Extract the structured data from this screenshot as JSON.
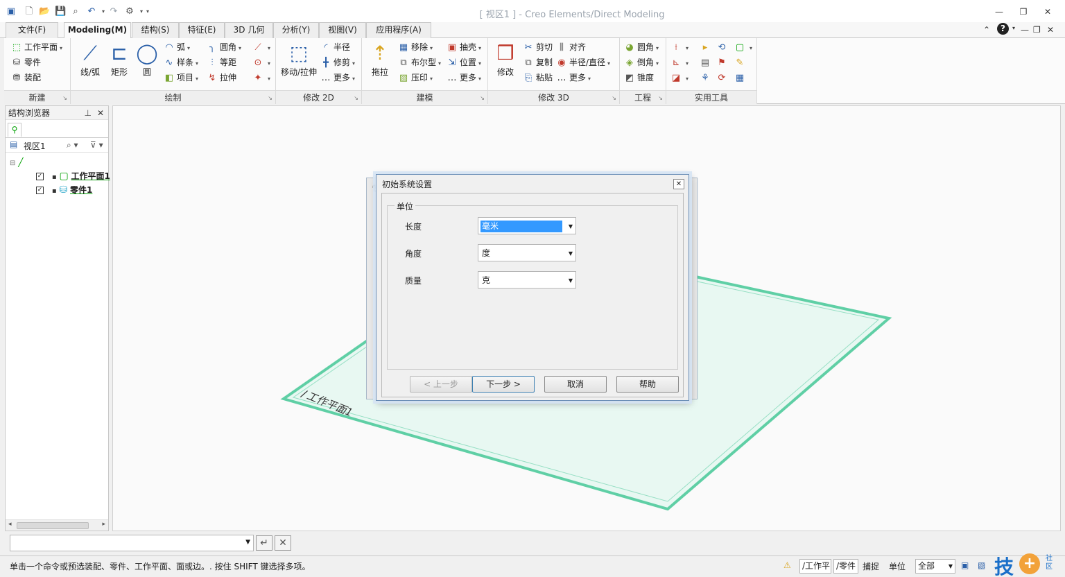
{
  "window": {
    "title": "[ 视区1 ] - Creo Elements/Direct Modeling",
    "accent_color": "#2a5fa8"
  },
  "tabs": [
    {
      "label": "文件(F)"
    },
    {
      "label": "Modeling(M)",
      "active": true
    },
    {
      "label": "结构(S)"
    },
    {
      "label": "特征(E)"
    },
    {
      "label": "3D 几何"
    },
    {
      "label": "分析(Y)"
    },
    {
      "label": "视图(V)"
    },
    {
      "label": "应用程序(A)"
    }
  ],
  "ribbon": {
    "new_group": {
      "label": "新建",
      "items": [
        "工作平面",
        "零件",
        "装配"
      ]
    },
    "draw_group": {
      "label": "绘制",
      "big": [
        "线/弧",
        "矩形",
        "圆"
      ],
      "small": [
        "弧",
        "样条",
        "项目",
        "圆角",
        "等距",
        "拉伸"
      ]
    },
    "modify2d_group": {
      "label": "修改 2D",
      "big": "移动/拉伸",
      "small": [
        "半径",
        "修剪",
        "更多"
      ]
    },
    "model_group": {
      "label": "建模",
      "big": "拖拉",
      "small": [
        "移除",
        "布尔型",
        "压印",
        "抽壳",
        "位置",
        "更多"
      ]
    },
    "modify3d_group": {
      "label": "修改 3D",
      "big": "修改",
      "small": [
        "剪切",
        "复制",
        "粘贴",
        "对齐",
        "半径/直径",
        "更多"
      ]
    },
    "eng_group": {
      "label": "工程",
      "small": [
        "圆角",
        "倒角",
        "锥度"
      ]
    },
    "util_group": {
      "label": "实用工具"
    }
  },
  "browser": {
    "title": "结构浏览器",
    "view_label": "视区1",
    "items": [
      {
        "label": "工作平面1",
        "checked": true,
        "color": "#00a000"
      },
      {
        "label": "零件1",
        "checked": true,
        "color": "#00a000"
      }
    ]
  },
  "viewport": {
    "plane_label": "/工作平面1",
    "plane_color": "#5fcfa5",
    "plane_fill": "#e8f8f2"
  },
  "dialog": {
    "title": "初始系统设置",
    "group_label": "单位",
    "fields": [
      {
        "label": "长度",
        "value": "毫米",
        "selected": true
      },
      {
        "label": "角度",
        "value": "度"
      },
      {
        "label": "质量",
        "value": "克"
      }
    ],
    "buttons": {
      "prev": "< 上一步",
      "next": "下一步 >",
      "cancel": "取消",
      "help": "帮助"
    }
  },
  "statusbar": {
    "message": "单击一个命令或预选装配、零件、工作平面、面或边。. 按住 SHIFT 键选择多项。",
    "wp": "/工作平",
    "part": "/零件",
    "snap": "捕捉",
    "unit": "单位",
    "filter": "全部"
  }
}
